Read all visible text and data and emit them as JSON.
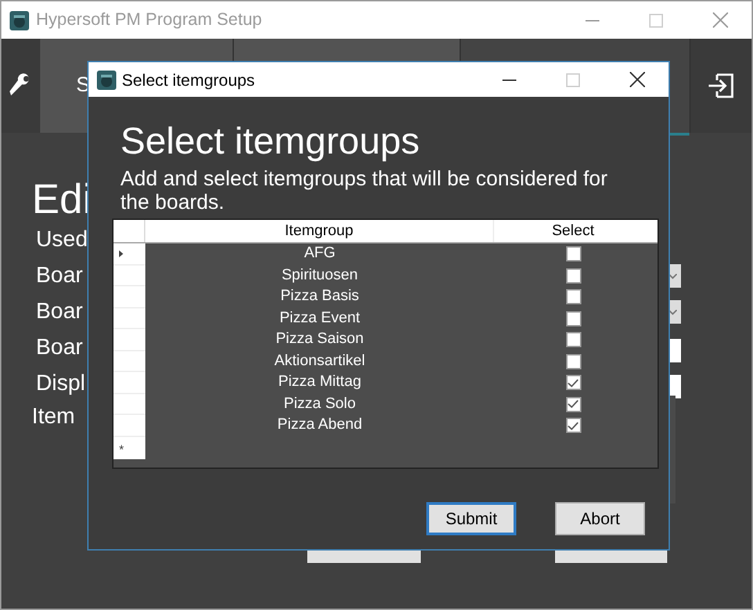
{
  "main_window": {
    "title": "Hypersoft PM Program Setup",
    "tabs": [
      {
        "label": "S",
        "selected": false
      },
      {
        "selected": false
      },
      {
        "selected": true
      }
    ],
    "heading": "Edi",
    "fields": [
      {
        "label": "Used",
        "kind": "text"
      },
      {
        "label": "Boar",
        "kind": "dropdown"
      },
      {
        "label": "Boar",
        "kind": "dropdown"
      },
      {
        "label": "Boar",
        "kind": "textbox"
      },
      {
        "label": "Displ",
        "kind": "textbox"
      },
      {
        "label": "Item",
        "kind": "list"
      }
    ]
  },
  "dialog": {
    "title": "Select itemgroups",
    "heading": "Select itemgroups",
    "description": "Add and select itemgroups that will be considered for the boards.",
    "columns": [
      "Itemgroup",
      "Select"
    ],
    "rows": [
      {
        "itemgroup": "AFG",
        "checked": false,
        "current": true
      },
      {
        "itemgroup": "Spirituosen",
        "checked": false,
        "current": false
      },
      {
        "itemgroup": "Pizza Basis",
        "checked": false,
        "current": false
      },
      {
        "itemgroup": "Pizza Event",
        "checked": false,
        "current": false
      },
      {
        "itemgroup": "Pizza Saison",
        "checked": false,
        "current": false
      },
      {
        "itemgroup": "Aktionsartikel",
        "checked": false,
        "current": false
      },
      {
        "itemgroup": "Pizza Mittag",
        "checked": true,
        "current": false
      },
      {
        "itemgroup": "Pizza Solo",
        "checked": true,
        "current": false
      },
      {
        "itemgroup": "Pizza Abend",
        "checked": true,
        "current": false
      }
    ],
    "new_row_marker": "*",
    "buttons": [
      {
        "label": "Submit",
        "focused": true
      },
      {
        "label": "Abort",
        "focused": false
      }
    ]
  }
}
